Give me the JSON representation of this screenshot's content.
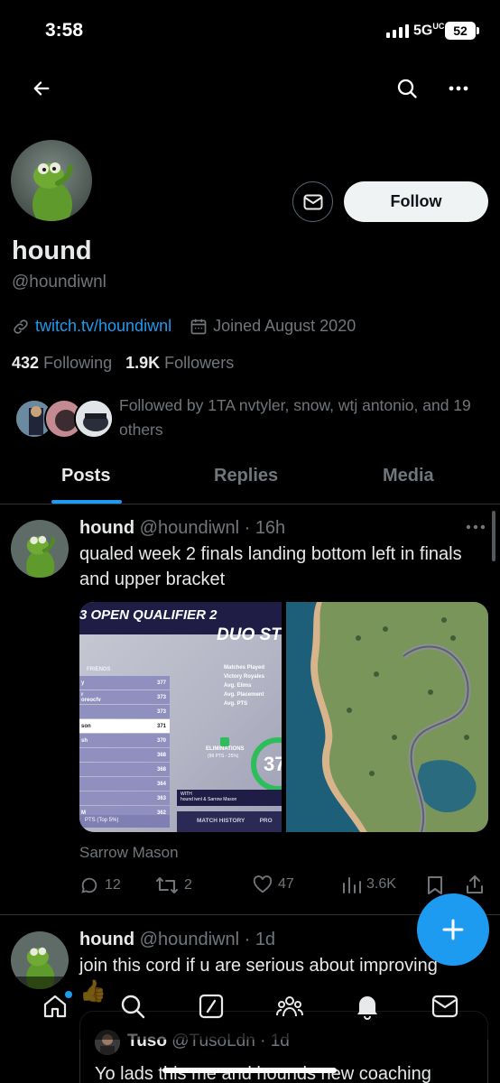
{
  "status": {
    "time": "3:58",
    "network": "5G",
    "network_sup": "UC",
    "battery": "52"
  },
  "profile": {
    "name": "hound",
    "handle": "@houndiwnl",
    "link": "twitch.tv/houndiwnl",
    "joined": "Joined August 2020",
    "following_count": "432",
    "following_label": "Following",
    "followers_count": "1.9K",
    "followers_label": "Followers",
    "followed_by": "Followed by 1TA nvtyler, snow, wtj antonio, and 19 others",
    "follow_label": "Follow"
  },
  "tabs": [
    {
      "label": "Posts",
      "active": true
    },
    {
      "label": "Replies",
      "active": false
    },
    {
      "label": "Media",
      "active": false
    }
  ],
  "posts": [
    {
      "name": "hound",
      "handle": "@houndiwnl",
      "time": "16h",
      "text": "qualed week 2 finals landing bottom left in finals and upper bracket",
      "tagged": "Sarrow Mason",
      "replies": "12",
      "reposts": "2",
      "likes": "47",
      "views": "3.6K",
      "media": {
        "header": "3 OPEN QUALIFIER 2",
        "subheader": "DUO ST",
        "friends_label": "FRIENDS",
        "rows": [
          {
            "name": "y",
            "score": "377"
          },
          {
            "name": "r oreocfv",
            "score": "373"
          },
          {
            "name": "",
            "score": "373"
          },
          {
            "name": "son",
            "score": "371"
          },
          {
            "name": "sh",
            "score": "370"
          },
          {
            "name": "",
            "score": "368"
          },
          {
            "name": "",
            "score": "368"
          },
          {
            "name": "",
            "score": "364"
          },
          {
            "name": "",
            "score": "363"
          },
          {
            "name": "M",
            "score": "362"
          }
        ],
        "footer_pts": "PTS (Top 5%)",
        "stats": [
          "Matches Played",
          "Victory Royales",
          "Avg. Elims",
          "Avg. Placement",
          "Avg. PTS"
        ],
        "elims_label": "ELIMINATIONS",
        "elims_sub": "(96 PTS - 25%)",
        "big_number": "37",
        "with_label": "WITH",
        "with_names": "hound iwnl & Sarrow Mason",
        "match_history": "MATCH HISTORY",
        "pro": "PRO"
      }
    },
    {
      "name": "hound",
      "handle": "@houndiwnl",
      "time": "1d",
      "text": "join this cord if u are serious about improving",
      "emoji": "👍",
      "quote": {
        "name": "Tuso",
        "handle": "@TusoLdn",
        "time": "1d",
        "text": "Yo lads this me and hounds new coaching"
      }
    }
  ],
  "colors": {
    "accent": "#1d9bf0",
    "background": "#000000",
    "muted": "#71767b"
  }
}
